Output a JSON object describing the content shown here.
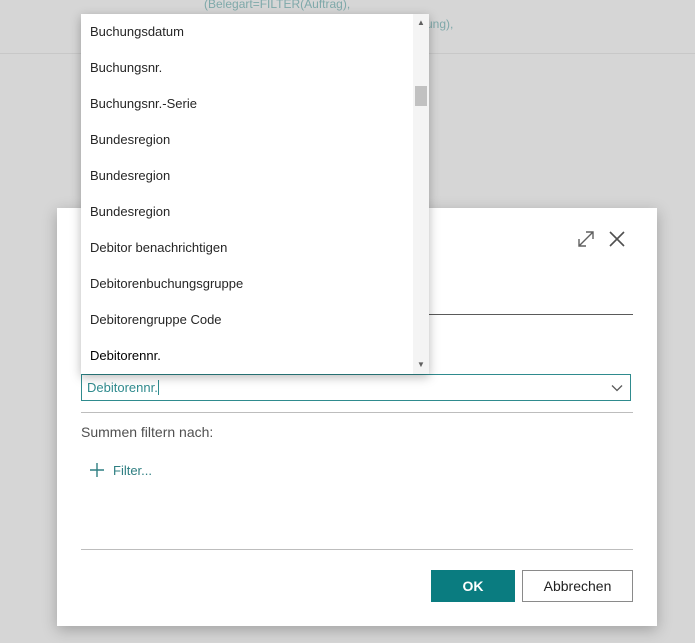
{
  "background": {
    "line1": "(Belegart=FILTER(Auftrag),",
    "line2": "itung),"
  },
  "dropdown": {
    "items": [
      "Buchungsdatum",
      "Buchungsnr.",
      "Buchungsnr.-Serie",
      "Bundesregion",
      "Bundesregion",
      "Bundesregion",
      "Debitor benachrichtigen",
      "Debitorenbuchungsgruppe",
      "Debitorengruppe Code",
      "Debitorennr."
    ]
  },
  "dialog": {
    "selected_field": "Debitorennr.",
    "filter_label": "Summen filtern nach:",
    "add_filter_label": "Filter...",
    "ok_label": "OK",
    "cancel_label": "Abbrechen"
  },
  "colors": {
    "accent": "#0a7c80",
    "link": "#2f7f82"
  },
  "icons": [
    "expand-icon",
    "close-icon",
    "chevron-down-icon",
    "plus-icon",
    "scroll-up-icon",
    "scroll-down-icon"
  ]
}
